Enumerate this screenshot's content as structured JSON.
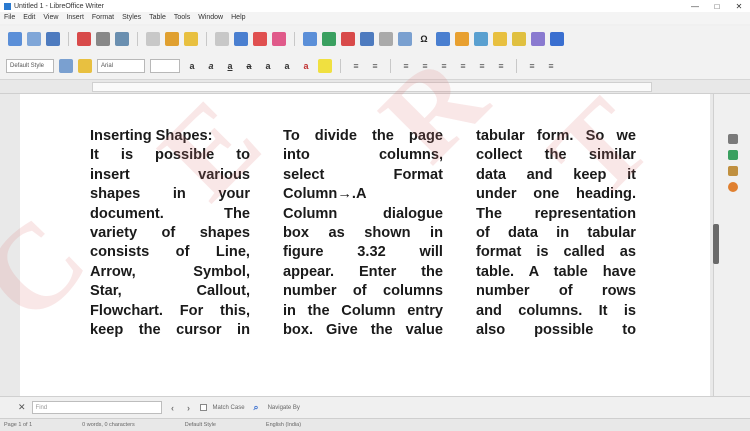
{
  "window": {
    "title": "Untitled 1 - LibreOffice Writer",
    "controls": [
      "—",
      "□",
      "✕"
    ]
  },
  "menu": [
    "File",
    "Edit",
    "View",
    "Insert",
    "Format",
    "Styles",
    "Table",
    "Tools",
    "Window",
    "Help"
  ],
  "toolbar2": {
    "style": "Default Style",
    "font": "Arial"
  },
  "document": {
    "col1": [
      "Inserting Shapes:",
      "It is possible to",
      "insert various",
      "shapes in your",
      "document. The",
      "variety of shapes",
      "consists of Line,",
      "Arrow, Symbol,",
      "Star, Callout,",
      "Flowchart. For this,",
      "keep the cursor in"
    ],
    "col2": [
      "To divide the page",
      "into columns,",
      "select Format",
      "Column→.A",
      "Column dialogue",
      "box as shown in",
      "figure 3.32 will",
      "appear. Enter the",
      "number of columns",
      "in the Column entry",
      "box. Give the value"
    ],
    "col3": [
      "tabular form. So we",
      "collect the similar",
      "data and keep it",
      "under one heading.",
      "The representation",
      "of data in tabular",
      "format is called as",
      "table. A table have",
      "number of rows",
      "and columns. It is",
      "also possible to"
    ]
  },
  "findbar": {
    "placeholder": "Find",
    "match_case": "Match Case",
    "navigate": "Navigate By"
  },
  "statusbar": [
    "Page 1 of 1",
    "0 words, 0 characters",
    "Default Style",
    "English (India)"
  ],
  "watermark": [
    "C",
    "E",
    "R",
    "T"
  ]
}
